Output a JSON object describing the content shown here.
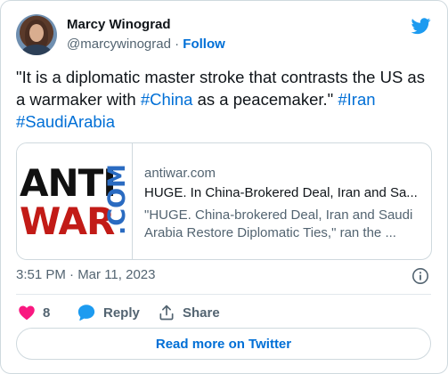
{
  "author": {
    "name": "Marcy Winograd",
    "handle": "@marcywinograd",
    "separator": "·",
    "follow_label": "Follow"
  },
  "tweet": {
    "text_parts": [
      {
        "text": "\"It is a diplomatic master stroke that contrasts the US as a warmaker with ",
        "tag": false
      },
      {
        "text": "#China",
        "tag": true
      },
      {
        "text": " as a peacemaker.\" ",
        "tag": false
      },
      {
        "text": "#Iran",
        "tag": true
      },
      {
        "text": " ",
        "tag": false
      },
      {
        "text": "#SaudiArabia",
        "tag": true
      }
    ]
  },
  "link_card": {
    "logo_text_anti": "ANTI",
    "logo_text_war": "WAR",
    "logo_text_com": ".COM",
    "domain": "antiwar.com",
    "title": "HUGE. In China-Brokered Deal, Iran and Sa...",
    "description": "\"HUGE. China-brokered Deal, Iran and Saudi Arabia Restore Diplomatic Ties,\" ran the ..."
  },
  "meta": {
    "timestamp": "3:51 PM · Mar 11, 2023"
  },
  "actions": {
    "like_count": "8",
    "reply_label": "Reply",
    "share_label": "Share"
  },
  "footer": {
    "read_more_label": "Read more on Twitter"
  },
  "colors": {
    "accent": "#006fd6",
    "twitter_blue": "#1d9bf0",
    "like_pink": "#f91880",
    "muted": "#536471"
  },
  "icons": {
    "brand": "twitter-bird-icon",
    "info": "info-icon",
    "like": "heart-icon",
    "reply": "speech-bubble-icon",
    "share": "share-upload-icon"
  }
}
